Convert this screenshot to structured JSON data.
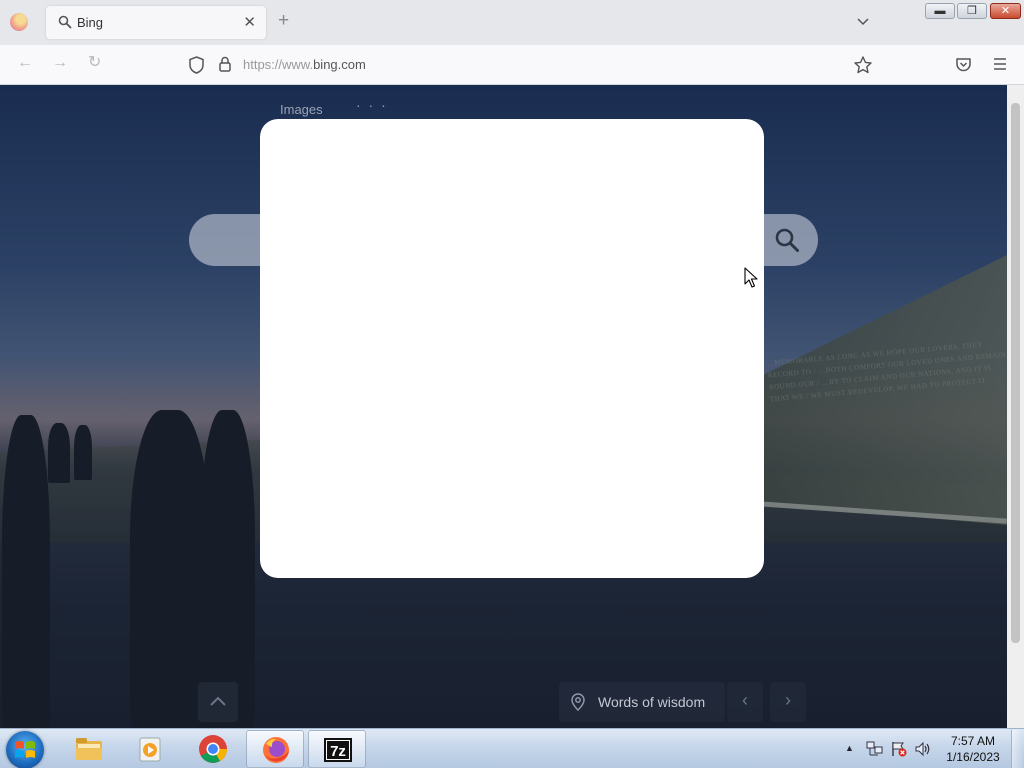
{
  "browser": {
    "tab": {
      "title": "Bing"
    },
    "address": {
      "scheme": "https://www.",
      "host": "bing.com"
    }
  },
  "page": {
    "nav": {
      "images": "Images",
      "more": "· · ·"
    },
    "wall_inscription": "…MEMORABLE AS LONG AS WE HOPE OUR LOVERS, THEY RECORD TO / …BOTH COMFORT OUR LOVED ONES AND REMAIN BOUND OUR / …BY TO CLAIM AND OUR NATIONS, AND IT IS THAT WE / WE MUST REDEVELOP, WE HAD TO PROTECT IT",
    "wisdom_label": "Words of wisdom"
  },
  "taskbar": {
    "apps": [
      "file-explorer",
      "media-player",
      "chrome",
      "firefox",
      "7-zip"
    ],
    "clock": {
      "time": "7:57 AM",
      "date": "1/16/2023"
    }
  },
  "colors": {
    "taskbar": "#c6d6ea",
    "modal": "#ffffff",
    "firefox_orange": "#ff7139"
  }
}
